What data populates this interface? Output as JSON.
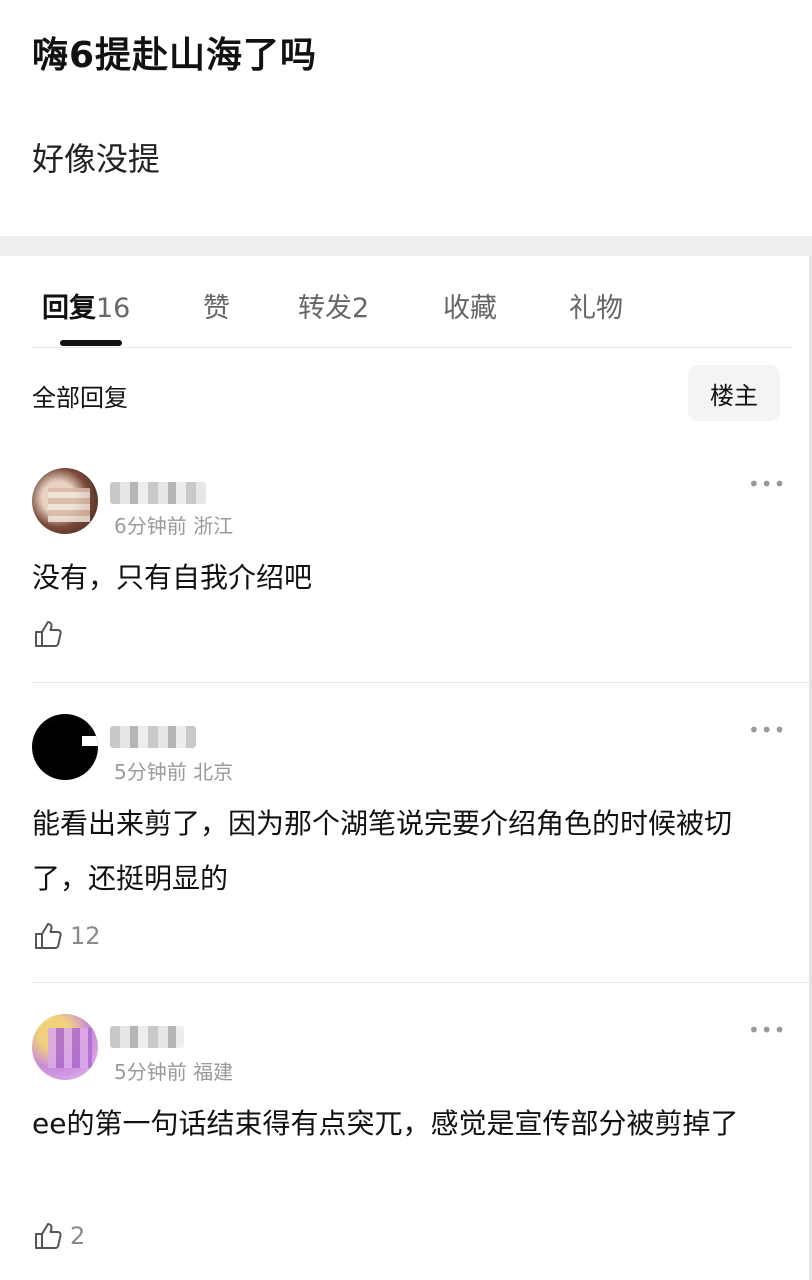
{
  "post": {
    "title": "嗨6提赴山海了吗",
    "body": "好像没提"
  },
  "tabs": [
    {
      "label": "回复",
      "count": "16"
    },
    {
      "label": "赞",
      "count": ""
    },
    {
      "label": "转发",
      "count": "2"
    },
    {
      "label": "收藏",
      "count": ""
    },
    {
      "label": "礼物",
      "count": ""
    }
  ],
  "replies_header": {
    "title": "全部回复",
    "filter_label": "楼主"
  },
  "comments": [
    {
      "time_location": "6分钟前 浙江",
      "text": "没有，只有自我介绍吧",
      "likes": ""
    },
    {
      "time_location": "5分钟前 北京",
      "text": "能看出来剪了，因为那个湖笔说完要介绍角色的时候被切了，还挺明显的",
      "likes": "12"
    },
    {
      "time_location": "5分钟前 福建",
      "text": "ee的第一句话结束得有点突兀，感觉是宣传部分被剪掉了",
      "likes": "2"
    }
  ],
  "icons": {
    "more": "more-horizontal-icon",
    "like": "thumbs-up-icon"
  }
}
